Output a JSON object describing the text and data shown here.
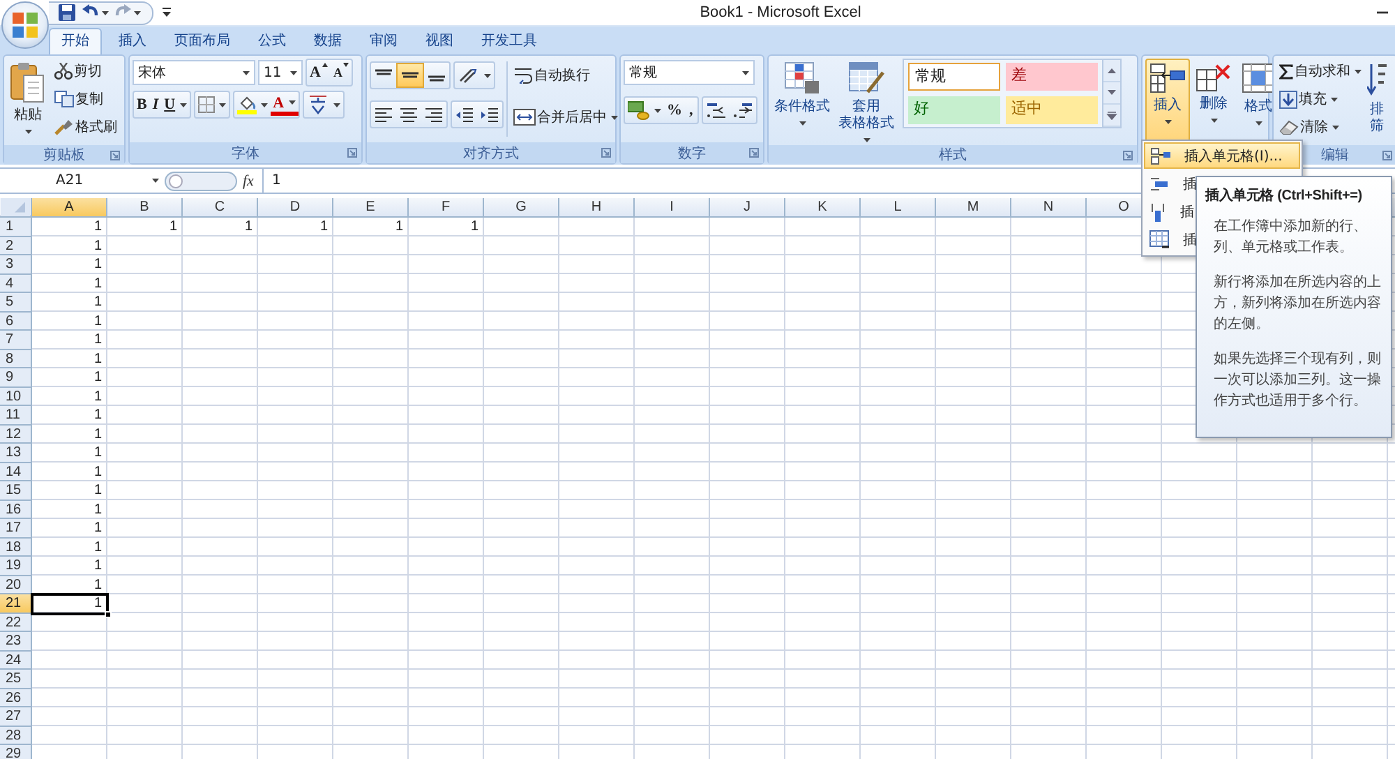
{
  "window": {
    "title": "Book1 - Microsoft Excel"
  },
  "tabs": [
    {
      "label": "开始",
      "selected": true
    },
    {
      "label": "插入",
      "selected": false
    },
    {
      "label": "页面布局",
      "selected": false
    },
    {
      "label": "公式",
      "selected": false
    },
    {
      "label": "数据",
      "selected": false
    },
    {
      "label": "审阅",
      "selected": false
    },
    {
      "label": "视图",
      "selected": false
    },
    {
      "label": "开发工具",
      "selected": false
    }
  ],
  "ribbon": {
    "clipboard": {
      "label": "剪贴板",
      "paste": "粘贴",
      "cut": "剪切",
      "copy": "复制",
      "format_painter": "格式刷"
    },
    "font": {
      "label": "字体",
      "font_name": "宋体",
      "font_size": "11",
      "grow": "A",
      "shrink": "A",
      "bold": "B",
      "italic": "I",
      "underline": "U",
      "font_color": "A"
    },
    "alignment": {
      "label": "对齐方式",
      "vertical": [
        {
          "selected": false
        },
        {
          "selected": true
        },
        {
          "selected": false
        }
      ],
      "wrap_text": "自动换行",
      "merge_center": "合并后居中"
    },
    "number": {
      "label": "数字",
      "format": "常规",
      "percent": "%",
      "comma": ","
    },
    "styles": {
      "label": "样式",
      "conditional_formatting": "条件格式",
      "format_as_table": [
        "套用",
        "表格格式"
      ],
      "cell_styles": [
        {
          "label": "常规",
          "kind": "normal"
        },
        {
          "label": "差",
          "kind": "bad"
        },
        {
          "label": "好",
          "kind": "good"
        },
        {
          "label": "适中",
          "kind": "neutral"
        }
      ]
    },
    "cells": {
      "insert": "插入",
      "insert_selected": true,
      "delete": "删除",
      "format": "格式"
    },
    "editing": {
      "label": "编辑",
      "autosum": "自动求和",
      "fill": "填充",
      "clear": "清除",
      "sort_filter": [
        "排",
        "筛"
      ]
    }
  },
  "formula_bar": {
    "name_box": "A21",
    "fx": "fx",
    "value": "1"
  },
  "sheet": {
    "columns": [
      {
        "label": "A",
        "selected": true
      },
      {
        "label": "B",
        "selected": false
      },
      {
        "label": "C",
        "selected": false
      },
      {
        "label": "D",
        "selected": false
      },
      {
        "label": "E",
        "selected": false
      },
      {
        "label": "F",
        "selected": false
      },
      {
        "label": "G",
        "selected": false
      },
      {
        "label": "H",
        "selected": false
      },
      {
        "label": "I",
        "selected": false
      },
      {
        "label": "J",
        "selected": false
      },
      {
        "label": "K",
        "selected": false
      },
      {
        "label": "L",
        "selected": false
      },
      {
        "label": "M",
        "selected": false
      },
      {
        "label": "N",
        "selected": false
      },
      {
        "label": "O",
        "selected": false
      }
    ],
    "rows": [
      {
        "header": "1",
        "selected": false,
        "cells": [
          "1",
          "1",
          "1",
          "1",
          "1",
          "1"
        ]
      },
      {
        "header": "2",
        "selected": false,
        "cells": [
          "1"
        ]
      },
      {
        "header": "3",
        "selected": false,
        "cells": [
          "1"
        ]
      },
      {
        "header": "4",
        "selected": false,
        "cells": [
          "1"
        ]
      },
      {
        "header": "5",
        "selected": false,
        "cells": [
          "1"
        ]
      },
      {
        "header": "6",
        "selected": false,
        "cells": [
          "1"
        ]
      },
      {
        "header": "7",
        "selected": false,
        "cells": [
          "1"
        ]
      },
      {
        "header": "8",
        "selected": false,
        "cells": [
          "1"
        ]
      },
      {
        "header": "9",
        "selected": false,
        "cells": [
          "1"
        ]
      },
      {
        "header": "10",
        "selected": false,
        "cells": [
          "1"
        ]
      },
      {
        "header": "11",
        "selected": false,
        "cells": [
          "1"
        ]
      },
      {
        "header": "12",
        "selected": false,
        "cells": [
          "1"
        ]
      },
      {
        "header": "13",
        "selected": false,
        "cells": [
          "1"
        ]
      },
      {
        "header": "14",
        "selected": false,
        "cells": [
          "1"
        ]
      },
      {
        "header": "15",
        "selected": false,
        "cells": [
          "1"
        ]
      },
      {
        "header": "16",
        "selected": false,
        "cells": [
          "1"
        ]
      },
      {
        "header": "17",
        "selected": false,
        "cells": [
          "1"
        ]
      },
      {
        "header": "18",
        "selected": false,
        "cells": [
          "1"
        ]
      },
      {
        "header": "19",
        "selected": false,
        "cells": [
          "1"
        ]
      },
      {
        "header": "20",
        "selected": false,
        "cells": [
          "1"
        ]
      },
      {
        "header": "21",
        "selected": true,
        "cells": [
          "1"
        ]
      },
      {
        "header": "22",
        "selected": false,
        "cells": []
      },
      {
        "header": "23",
        "selected": false,
        "cells": []
      },
      {
        "header": "24",
        "selected": false,
        "cells": []
      },
      {
        "header": "25",
        "selected": false,
        "cells": []
      },
      {
        "header": "26",
        "selected": false,
        "cells": []
      },
      {
        "header": "27",
        "selected": false,
        "cells": []
      },
      {
        "header": "28",
        "selected": false,
        "cells": []
      },
      {
        "header": "29",
        "selected": false,
        "cells": []
      }
    ]
  },
  "insert_menu": {
    "items": [
      {
        "label": "插入单元格(I)...",
        "selected": true
      },
      {
        "label": "插",
        "selected": false
      },
      {
        "label": "插",
        "selected": false
      },
      {
        "label": "插",
        "selected": false
      }
    ]
  },
  "tooltip": {
    "title": "插入单元格 (Ctrl+Shift+=)",
    "paragraphs": [
      "在工作簿中添加新的行、列、单元格或工作表。",
      "新行将添加在所选内容的上方，新列将添加在所选内容的左侧。",
      "如果先选择三个现有列，则一次可以添加三列。这一操作方式也适用于多个行。"
    ]
  }
}
